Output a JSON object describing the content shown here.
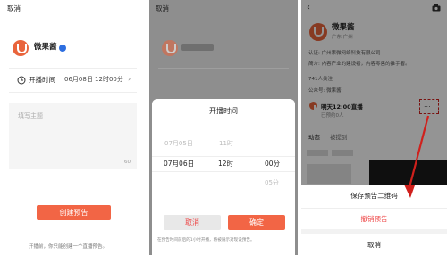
{
  "create_screen": {
    "cancel": "取消",
    "account_name": "微果酱",
    "time_label": "开播时间",
    "time_value": "06月08日 12时00分",
    "title_placeholder": "填写主题",
    "char_limit": "60",
    "create_button": "创建预告",
    "footer_note": "开播前，你只能创建一个直播预告。"
  },
  "picker_screen": {
    "cancel": "取消",
    "sheet_title": "开播时间",
    "rows": [
      {
        "date": "07月05日",
        "hour": "11时",
        "minute": ""
      },
      {
        "date": "07月06日",
        "hour": "12时",
        "minute": "00分"
      },
      {
        "date": "",
        "hour": "",
        "minute": "05分"
      }
    ],
    "cancel_button": "取消",
    "confirm_button": "确定",
    "note": "在预告时间前后的1小时开播，将被展示对现设预告。"
  },
  "profile_screen": {
    "account_name": "微果酱",
    "location": "广东 广州",
    "verified": "认证: 广州果微网络科技有限公司",
    "intro": "简介: 内容产业的建设者，内容零售的推手者。",
    "followers": "741人关注",
    "official_account": "公众号: 微果酱",
    "live_notice": "明天12:00直播",
    "reservations": "已预约0人",
    "more": "...",
    "tabs": [
      "动态",
      "被提到"
    ],
    "menu": {
      "save_qr": "保存预告二维码",
      "cancel_notice": "撤销预告",
      "cancel": "取消"
    }
  },
  "colors": {
    "accent": "#f26545",
    "brand": "#e9643c",
    "verify": "#2d6ee0",
    "annotation": "#d0201c"
  }
}
